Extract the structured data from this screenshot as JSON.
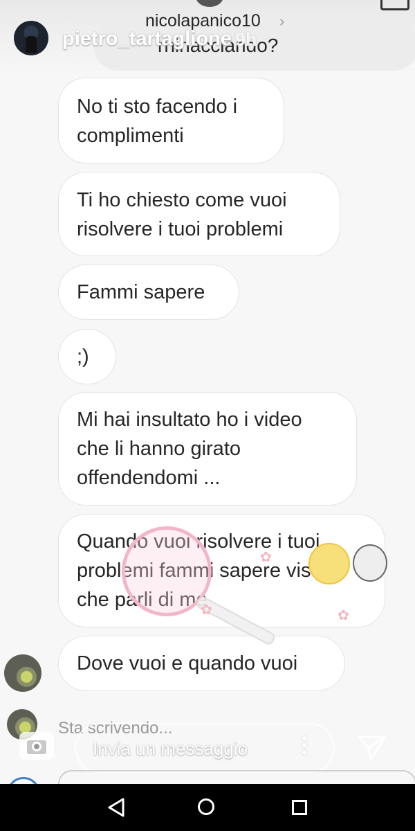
{
  "thread": {
    "handle": "nicolapanico10",
    "previous_fragment": "rninacciando?"
  },
  "story": {
    "poster_name": "pietro_tartaglione",
    "time_ago": "9h"
  },
  "messages": [
    "No ti sto facendo i\ncomplimenti",
    "Ti ho chiesto come vuoi\nrisolvere i tuoi problemi",
    "Fammi sapere",
    ";)",
    "Mi hai insultato ho i video\nche li hanno girato\noffendendomi ...",
    "Quando vuoi risolvere i tuoi\nproblemi fammi sapere visto\nche parli di me",
    "Dove vuoi e quando vuoi"
  ],
  "typing_indicator": "Sta scrivendo...",
  "composer": {
    "placeholder": "Invia un messaggio"
  },
  "icons": [
    "chevron-right-icon",
    "camera-icon",
    "more-icon",
    "send-icon",
    "back-icon",
    "home-icon",
    "recents-icon"
  ],
  "colors": {
    "bubble_bg": "#ffffff",
    "bubble_border": "#e3e3e3",
    "nav_bar": "#000000",
    "text": "#262626",
    "muted": "#9a9a9a"
  }
}
